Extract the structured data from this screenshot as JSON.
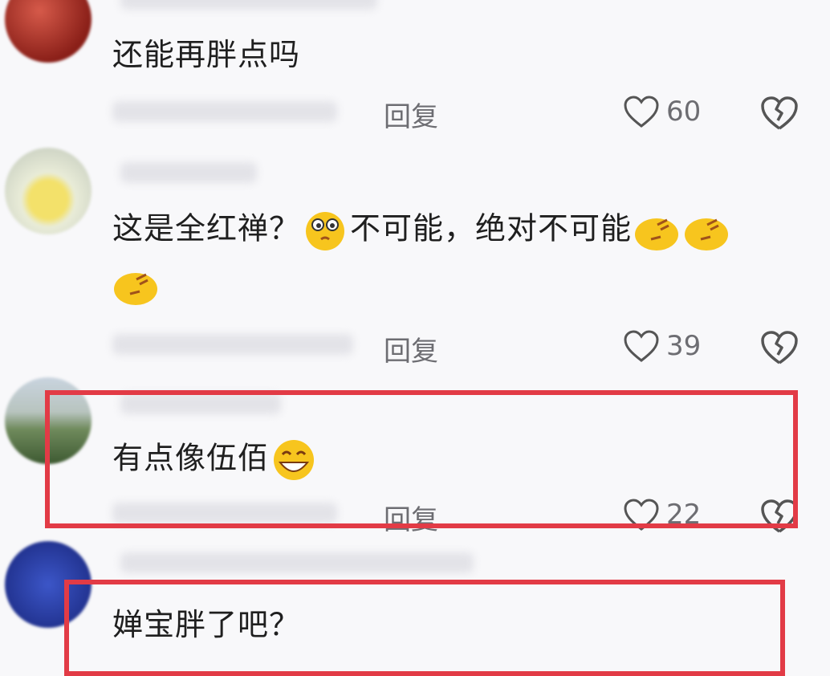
{
  "comments": [
    {
      "text": "还能再胖点吗",
      "reply": "回复",
      "likes": "60"
    },
    {
      "text_a": "这是全红禅？",
      "text_b": "不可能，绝对不可能",
      "reply": "回复",
      "likes": "39"
    },
    {
      "text": "有点像伍佰",
      "reply": "回复",
      "likes": "22"
    },
    {
      "text": "婵宝胖了吧？"
    }
  ],
  "icons": {
    "like": "heart-outline-icon",
    "dislike": "broken-heart-icon",
    "emojis": [
      "thinking-emoji",
      "sleepy-emoji",
      "grin-emoji"
    ]
  },
  "colors": {
    "highlight": "#e23b46",
    "meta_text": "#6d6d72"
  }
}
